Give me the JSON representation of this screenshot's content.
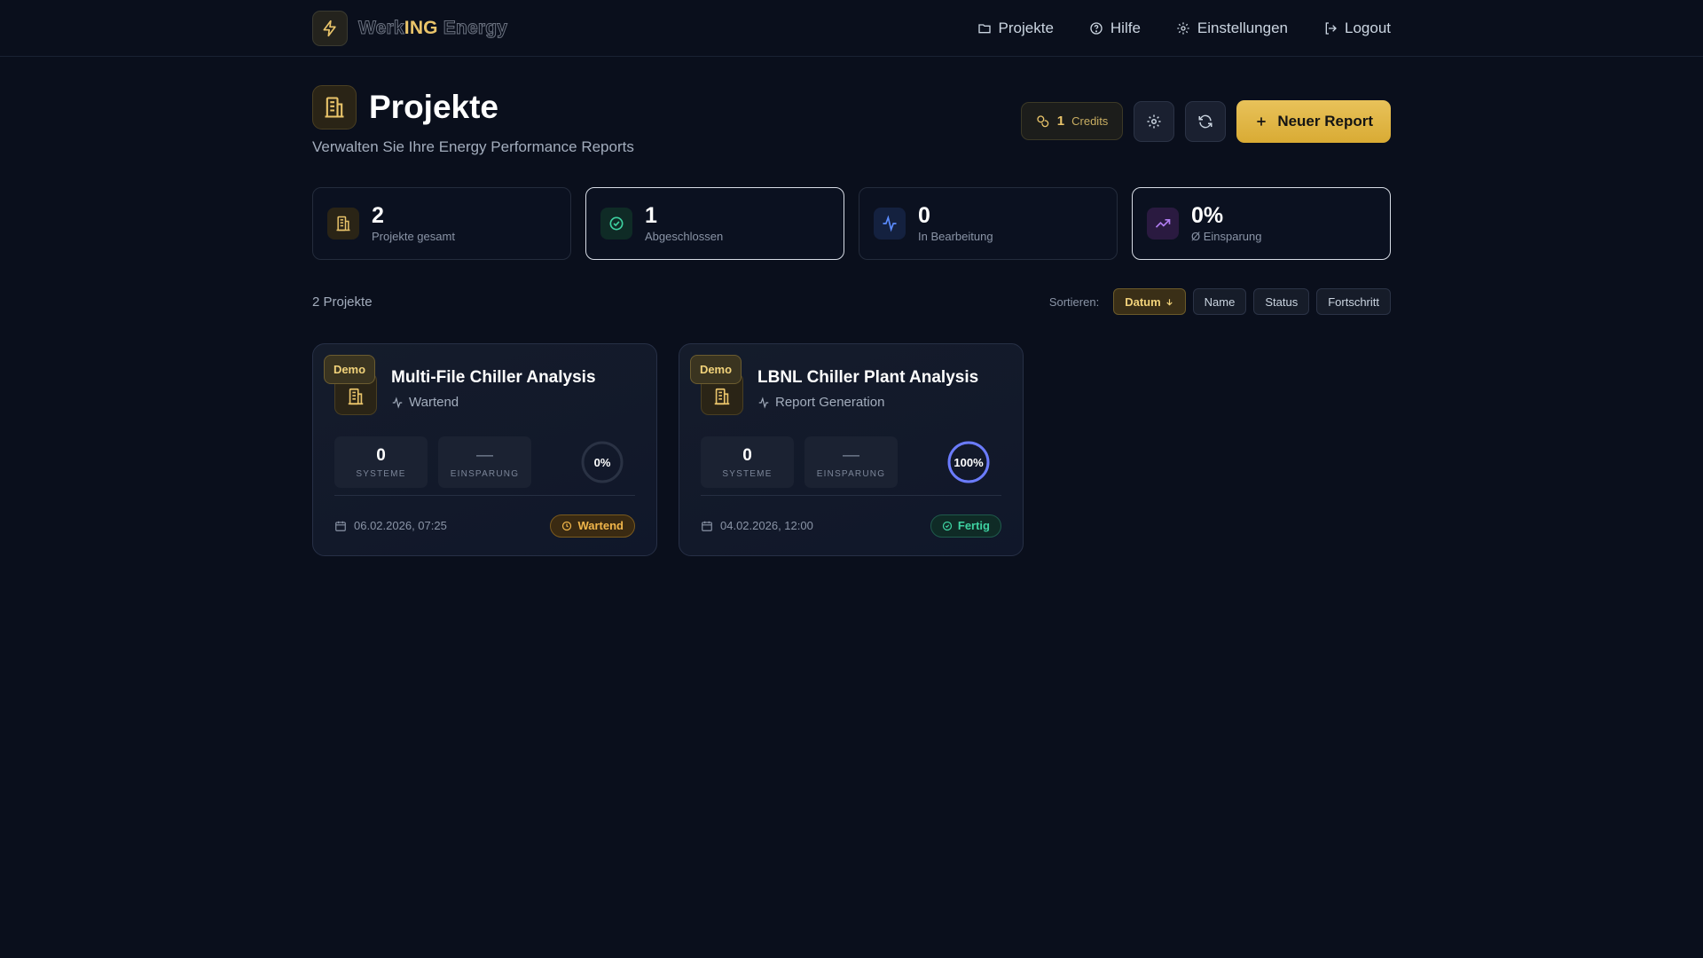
{
  "brand": {
    "name_part1": "Werk",
    "name_accent": "ING",
    "name_part2": " Energy"
  },
  "nav": {
    "items": [
      {
        "label": "Projekte",
        "icon": "folder-icon"
      },
      {
        "label": "Hilfe",
        "icon": "help-circle-icon"
      },
      {
        "label": "Einstellungen",
        "icon": "gear-icon"
      },
      {
        "label": "Logout",
        "icon": "logout-icon"
      }
    ]
  },
  "header": {
    "title": "Projekte",
    "subtitle": "Verwalten Sie Ihre Energy Performance Reports",
    "credits_value": "1",
    "credits_label": "Credits",
    "new_report_label": "Neuer Report"
  },
  "stats": [
    {
      "value": "2",
      "label": "Projekte gesamt",
      "icon": "building-icon",
      "color": "#e9c46a"
    },
    {
      "value": "1",
      "label": "Abgeschlossen",
      "icon": "check-circle-icon",
      "color": "#3ed1a1"
    },
    {
      "value": "0",
      "label": "In Bearbeitung",
      "icon": "activity-icon",
      "color": "#5b8cff"
    },
    {
      "value": "0%",
      "label": "Ø Einsparung",
      "icon": "trending-up-icon",
      "color": "#b07cf0"
    }
  ],
  "list": {
    "count_label": "2 Projekte",
    "sort_label": "Sortieren:",
    "sort_options": [
      "Datum",
      "Name",
      "Status",
      "Fortschritt"
    ],
    "active_sort": "Datum"
  },
  "projects": [
    {
      "badge": "Demo",
      "title": "Multi-File Chiller Analysis",
      "status": "Wartend",
      "systems_value": "0",
      "systems_label": "SYSTEME",
      "savings_value": "—",
      "savings_label": "EINSPARUNG",
      "progress": 0,
      "progress_label": "0%",
      "date": "06.02.2026, 07:25",
      "pill": "Wartend"
    },
    {
      "badge": "Demo",
      "title": "LBNL Chiller Plant Analysis",
      "status": "Report Generation",
      "systems_value": "0",
      "systems_label": "SYSTEME",
      "savings_value": "—",
      "savings_label": "EINSPARUNG",
      "progress": 100,
      "progress_label": "100%",
      "date": "04.02.2026, 12:00",
      "pill": "Fertig"
    }
  ],
  "colors": {
    "accent": "#e9c46a",
    "background": "#0a0f1c",
    "success": "#3ed1a1",
    "warning": "#f0b54a",
    "progress_ring": "#6b7cff"
  }
}
